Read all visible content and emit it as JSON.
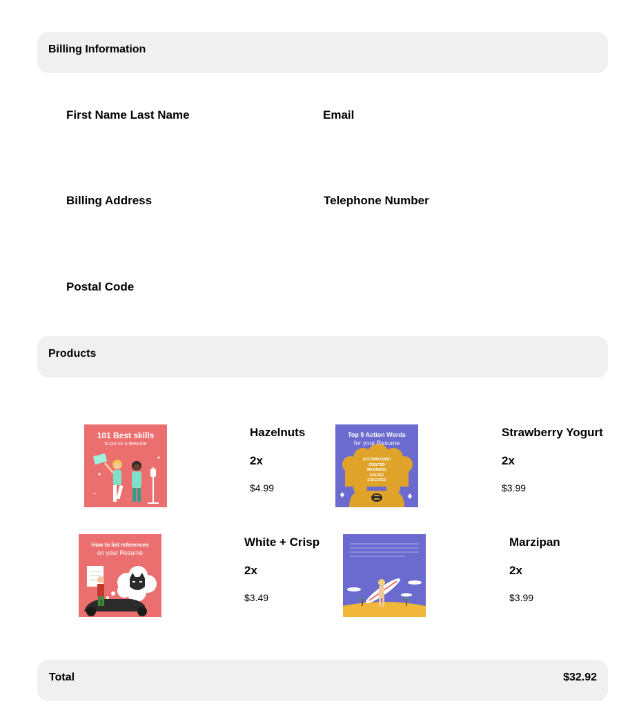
{
  "billing": {
    "header": "Billing Information",
    "fields": {
      "name": "First Name Last Name",
      "email": "Email",
      "address": "Billing Address",
      "telephone": "Telephone Number",
      "postal": "Postal Code"
    }
  },
  "products": {
    "header": "Products",
    "items": [
      {
        "name": "Hazelnuts",
        "quantity": "2x",
        "price": "$4.99",
        "thumbnail": {
          "title": "101 Best skills",
          "subtitle": "to put on a Resume",
          "bg": "#ec6f6f"
        }
      },
      {
        "name": "Strawberry Yogurt",
        "quantity": "2x",
        "price": "$3.99",
        "thumbnail": {
          "title": "Top 5 Action Words",
          "subtitle": "for your Resume",
          "words": "ACCOMPLISHED\nCREATED\nMAXIMIZED\nSOLVED\nEXECUTED",
          "bg": "#6b6bcf"
        }
      },
      {
        "name": "White + Crisp",
        "quantity": "2x",
        "price": "$3.49",
        "thumbnail": {
          "title": "How to list references",
          "subtitle": "on your Resume",
          "bg": "#ec6f6f"
        }
      },
      {
        "name": "Marzipan",
        "quantity": "2x",
        "price": "$3.99",
        "thumbnail": {
          "title": "",
          "subtitle": "",
          "bg": "#6b6bcf"
        }
      }
    ]
  },
  "total": {
    "label": "Total",
    "amount": "$32.92"
  }
}
